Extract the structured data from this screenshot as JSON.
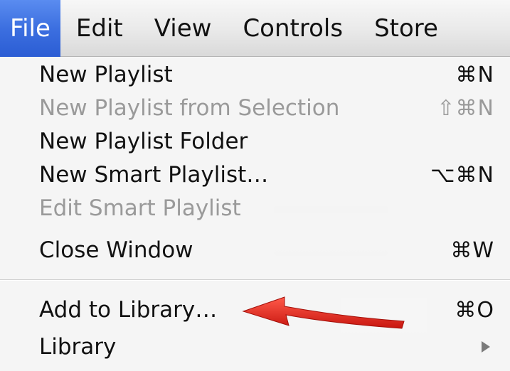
{
  "menubar": {
    "items": [
      {
        "label": "File",
        "active": true
      },
      {
        "label": "Edit"
      },
      {
        "label": "View"
      },
      {
        "label": "Controls"
      },
      {
        "label": "Store"
      }
    ]
  },
  "file_menu": {
    "items": [
      {
        "label": "New Playlist",
        "shortcut": "⌘N",
        "enabled": true
      },
      {
        "label": "New Playlist from Selection",
        "shortcut": "⇧⌘N",
        "enabled": false
      },
      {
        "label": "New Playlist Folder",
        "shortcut": "",
        "enabled": true
      },
      {
        "label": "New Smart Playlist…",
        "shortcut": "⌥⌘N",
        "enabled": true
      },
      {
        "label": "Edit Smart Playlist",
        "shortcut": "",
        "enabled": false
      },
      {
        "label": "Close Window",
        "shortcut": "⌘W",
        "enabled": true
      },
      {
        "label": "Add to Library…",
        "shortcut": "⌘O",
        "enabled": true
      },
      {
        "label": "Library",
        "shortcut": "",
        "submenu": true,
        "enabled": true
      }
    ]
  },
  "annotation": {
    "color": "#e3241b",
    "icon": "red-arrow-pointing-left"
  },
  "colors": {
    "highlight": "#3c6fe0",
    "disabled_text": "#9a9a9a"
  }
}
